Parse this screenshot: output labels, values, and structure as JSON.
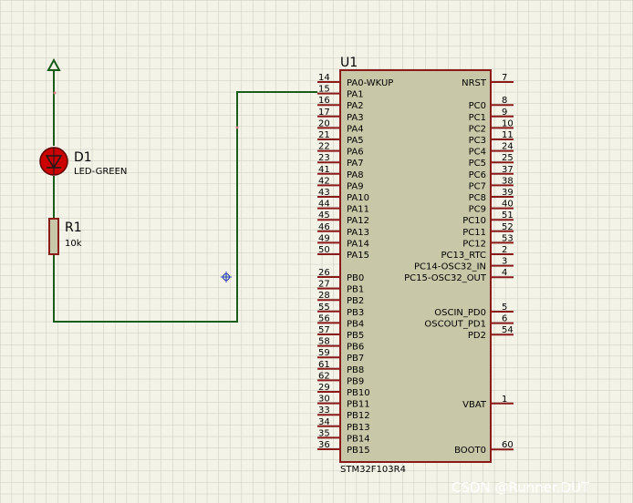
{
  "chip": {
    "ref": "U1",
    "part": "STM32F103R4",
    "left_pins": [
      {
        "num": "14",
        "name": "PA0-WKUP"
      },
      {
        "num": "15",
        "name": "PA1"
      },
      {
        "num": "16",
        "name": "PA2"
      },
      {
        "num": "17",
        "name": "PA3"
      },
      {
        "num": "20",
        "name": "PA4"
      },
      {
        "num": "21",
        "name": "PA5"
      },
      {
        "num": "22",
        "name": "PA6"
      },
      {
        "num": "23",
        "name": "PA7"
      },
      {
        "num": "41",
        "name": "PA8"
      },
      {
        "num": "42",
        "name": "PA9"
      },
      {
        "num": "43",
        "name": "PA10"
      },
      {
        "num": "44",
        "name": "PA11"
      },
      {
        "num": "45",
        "name": "PA12"
      },
      {
        "num": "46",
        "name": "PA13"
      },
      {
        "num": "49",
        "name": "PA14"
      },
      {
        "num": "50",
        "name": "PA15"
      },
      {
        "num": "26",
        "name": "PB0"
      },
      {
        "num": "27",
        "name": "PB1"
      },
      {
        "num": "28",
        "name": "PB2"
      },
      {
        "num": "55",
        "name": "PB3"
      },
      {
        "num": "56",
        "name": "PB4"
      },
      {
        "num": "57",
        "name": "PB5"
      },
      {
        "num": "58",
        "name": "PB6"
      },
      {
        "num": "59",
        "name": "PB7"
      },
      {
        "num": "61",
        "name": "PB8"
      },
      {
        "num": "62",
        "name": "PB9"
      },
      {
        "num": "29",
        "name": "PB10"
      },
      {
        "num": "30",
        "name": "PB11"
      },
      {
        "num": "33",
        "name": "PB12"
      },
      {
        "num": "34",
        "name": "PB13"
      },
      {
        "num": "35",
        "name": "PB14"
      },
      {
        "num": "36",
        "name": "PB15"
      }
    ],
    "right_pins": [
      {
        "num": "7",
        "name": "NRST"
      },
      {
        "num": "8",
        "name": "PC0"
      },
      {
        "num": "9",
        "name": "PC1"
      },
      {
        "num": "10",
        "name": "PC2"
      },
      {
        "num": "11",
        "name": "PC3"
      },
      {
        "num": "24",
        "name": "PC4"
      },
      {
        "num": "25",
        "name": "PC5"
      },
      {
        "num": "37",
        "name": "PC6"
      },
      {
        "num": "38",
        "name": "PC7"
      },
      {
        "num": "39",
        "name": "PC8"
      },
      {
        "num": "40",
        "name": "PC9"
      },
      {
        "num": "51",
        "name": "PC10"
      },
      {
        "num": "52",
        "name": "PC11"
      },
      {
        "num": "53",
        "name": "PC12"
      },
      {
        "num": "2",
        "name": "PC13_RTC"
      },
      {
        "num": "3",
        "name": "PC14-OSC32_IN"
      },
      {
        "num": "4",
        "name": "PC15-OSC32_OUT"
      },
      {
        "num": "5",
        "name": "OSCIN_PD0"
      },
      {
        "num": "6",
        "name": "OSCOUT_PD1"
      },
      {
        "num": "54",
        "name": "PD2"
      },
      {
        "num": "1",
        "name": "VBAT"
      },
      {
        "num": "60",
        "name": "BOOT0"
      }
    ]
  },
  "led": {
    "ref": "D1",
    "value": "LED-GREEN"
  },
  "resistor": {
    "ref": "R1",
    "value": "10k"
  },
  "watermark": "CSDN @Runner.DUT",
  "colors": {
    "background": "#f3f3e8",
    "grid": "#c9c9bc",
    "wire": "#1a5c1a",
    "chip_fill": "#c8c8a8",
    "chip_border": "#8b1a1a",
    "pin": "#8b1a1a",
    "resistor_fill": "#c8c8a8",
    "led_fill": "#cc0000"
  }
}
